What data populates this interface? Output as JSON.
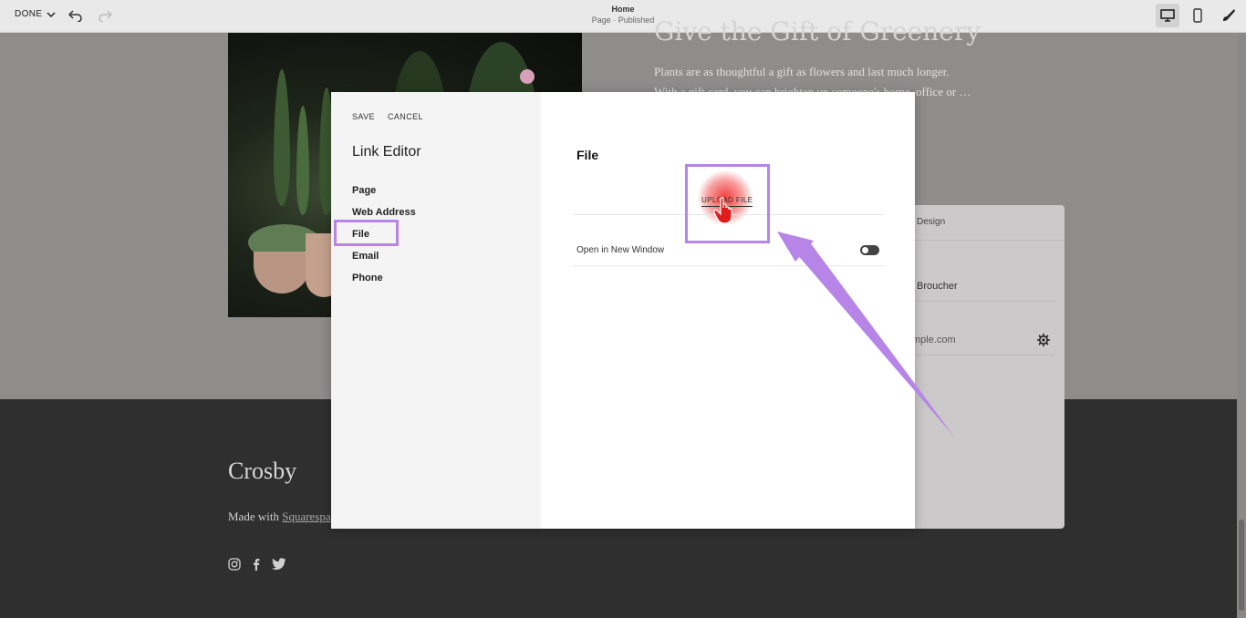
{
  "toolbar": {
    "done_label": "DONE",
    "page_title": "Home",
    "page_status": "Page · Published"
  },
  "site": {
    "heading": "Give the Gift of Greenery",
    "body": "Plants are as thoughtful a gift as flowers and last much longer. With a gift card, you can brighten up someone's home, office or … available",
    "footer_brand": "Crosby",
    "made_with_prefix": "Made with ",
    "made_with_link": "Squarespa"
  },
  "back_panel": {
    "tab": "Design",
    "name_value": "Broucher",
    "email_value": "mple.com"
  },
  "link_editor": {
    "save_label": "SAVE",
    "cancel_label": "CANCEL",
    "title": "Link Editor",
    "nav": [
      "Page",
      "Web Address",
      "File",
      "Email",
      "Phone"
    ],
    "selected": "File",
    "panel_title": "File",
    "upload_label": "UPLOAD FILE",
    "open_new_window_label": "Open in New Window",
    "open_new_window_on": false
  },
  "colors": {
    "highlight": "#b784e8",
    "click_indicator": "#f02828"
  },
  "icons": [
    "chevron-down-icon",
    "undo-icon",
    "redo-icon",
    "desktop-icon",
    "mobile-icon",
    "brush-icon",
    "instagram-icon",
    "facebook-icon",
    "twitter-icon",
    "gear-icon",
    "hand-pointer-icon",
    "arrow-icon"
  ]
}
